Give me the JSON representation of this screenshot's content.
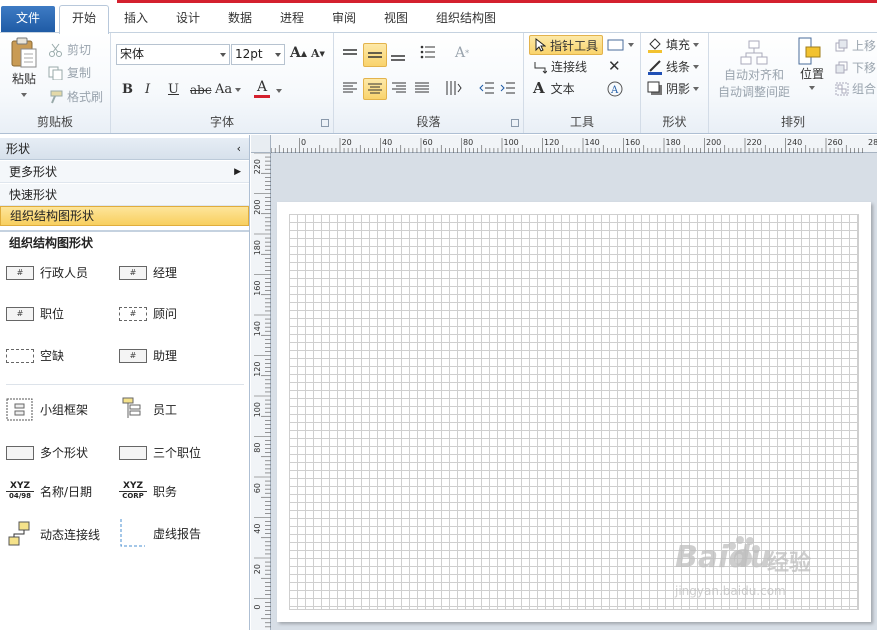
{
  "tabs": {
    "file": "文件",
    "home": "开始",
    "insert": "插入",
    "design": "设计",
    "data": "数据",
    "process": "进程",
    "review": "审阅",
    "view": "视图",
    "orgchart": "组织结构图"
  },
  "ribbon": {
    "clipboard": {
      "label": "剪贴板",
      "paste": "粘贴",
      "cut": "剪切",
      "copy": "复制",
      "format_painter": "格式刷"
    },
    "font": {
      "label": "字体",
      "family": "宋体",
      "size": "12pt",
      "bold": "B",
      "italic": "I",
      "underline": "U",
      "strike": "abc",
      "case": "Aa",
      "color_a": "A",
      "grow": "A",
      "shrink": "A"
    },
    "paragraph": {
      "label": "段落"
    },
    "tools": {
      "label": "工具",
      "pointer": "指针工具",
      "connector": "连接线",
      "text": "文本"
    },
    "shape": {
      "label": "形状",
      "fill": "填充",
      "line": "线条",
      "shadow": "阴影"
    },
    "arrange": {
      "label": "排列",
      "align_space": "自动对齐和",
      "auto_space": "自动调整间距",
      "position": "位置",
      "bring_forward": "上移",
      "send_backward": "下移",
      "group": "组合"
    }
  },
  "pane": {
    "header": "形状",
    "more_shapes": "更多形状",
    "quick_shapes": "快速形状",
    "org_shapes": "组织结构图形状",
    "stencil_title": "组织结构图形状",
    "shapes": [
      {
        "label": "行政人员"
      },
      {
        "label": "经理"
      },
      {
        "label": "职位"
      },
      {
        "label": "顾问"
      },
      {
        "label": "空缺"
      },
      {
        "label": "助理"
      },
      {
        "label": "小组框架"
      },
      {
        "label": "员工"
      },
      {
        "label": "多个形状"
      },
      {
        "label": "三个职位"
      },
      {
        "label": "名称/日期"
      },
      {
        "label": "职务"
      },
      {
        "label": "动态连接线"
      },
      {
        "label": "虚线报告"
      }
    ],
    "icon_text": {
      "xyz": "XYZ",
      "date": "04/98",
      "corp": "CORP"
    }
  },
  "ruler": {
    "h_labels": [
      "0",
      "20",
      "40",
      "60",
      "80",
      "100",
      "120",
      "140",
      "160",
      "180",
      "200",
      "220",
      "240",
      "260",
      "280"
    ],
    "v_labels": [
      "220",
      "200",
      "180",
      "160",
      "140",
      "120",
      "100",
      "80",
      "60",
      "40",
      "20",
      "0"
    ]
  },
  "watermark": {
    "brand": "Baidu",
    "sub": "经验",
    "url": "jingyan.baidu.com"
  },
  "colors": {
    "accent_red": "#d4202e",
    "file_tab": "#2a67b1",
    "highlight": "#f9d36c"
  }
}
